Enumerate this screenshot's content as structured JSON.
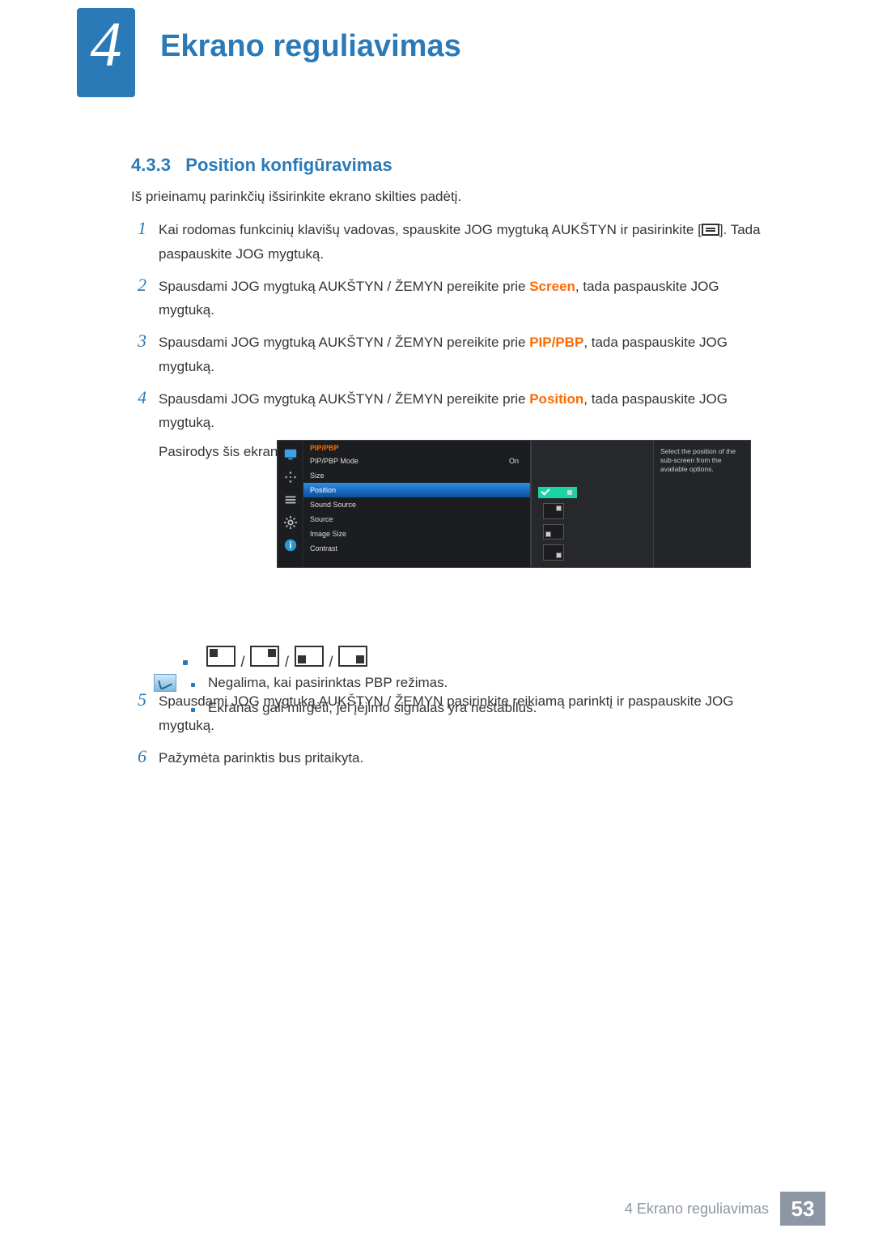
{
  "chapter": {
    "number": "4",
    "title": "Ekrano reguliavimas"
  },
  "section": {
    "number": "4.3.3",
    "title": "Position konfigūravimas"
  },
  "intro": "Iš prieinamų parinkčių išsirinkite ekrano skilties padėtį.",
  "steps": {
    "1": {
      "pre": "Kai rodomas funkcinių klavišų vadovas, spauskite JOG mygtuką AUKŠTYN ir pasirinkite [",
      "post": "]. Tada paspauskite JOG mygtuką."
    },
    "2": {
      "pre": "Spausdami JOG mygtuką AUKŠTYN / ŽEMYN pereikite prie ",
      "hl": "Screen",
      "post": ", tada paspauskite JOG mygtuką."
    },
    "3": {
      "pre": "Spausdami JOG mygtuką AUKŠTYN / ŽEMYN pereikite prie ",
      "hl": "PIP/PBP",
      "post": ", tada paspauskite JOG mygtuką."
    },
    "4": {
      "pre": "Spausdami JOG mygtuką AUKŠTYN / ŽEMYN pereikite prie ",
      "hl": "Position",
      "post": ", tada paspauskite JOG mygtuką.",
      "after": "Pasirodys šis ekrano rodinys:"
    },
    "5": "Spausdami JOG mygtuką AUKŠTYN / ŽEMYN pasirinkite reikiamą parinktį ir paspauskite JOG mygtuką.",
    "6": "Pažymėta parinktis bus pritaikyta."
  },
  "osd": {
    "title": "PIP/PBP",
    "items": {
      "mode": {
        "label": "PIP/PBP Mode",
        "value": "On"
      },
      "size": {
        "label": "Size"
      },
      "position": {
        "label": "Position"
      },
      "sound": {
        "label": "Sound Source"
      },
      "source": {
        "label": "Source"
      },
      "imgsize": {
        "label": "Image Size"
      },
      "contrast": {
        "label": "Contrast"
      }
    },
    "desc": "Select the position of the sub-screen from the available options."
  },
  "position_sep": "/",
  "notes": {
    "0": "Negalima, kai pasirinktas PBP režimas.",
    "1": "Ekranas gali mirgėti, jei įėjimo signalas yra nestabilus."
  },
  "footer": {
    "text": "4 Ekrano reguliavimas",
    "page": "53"
  }
}
